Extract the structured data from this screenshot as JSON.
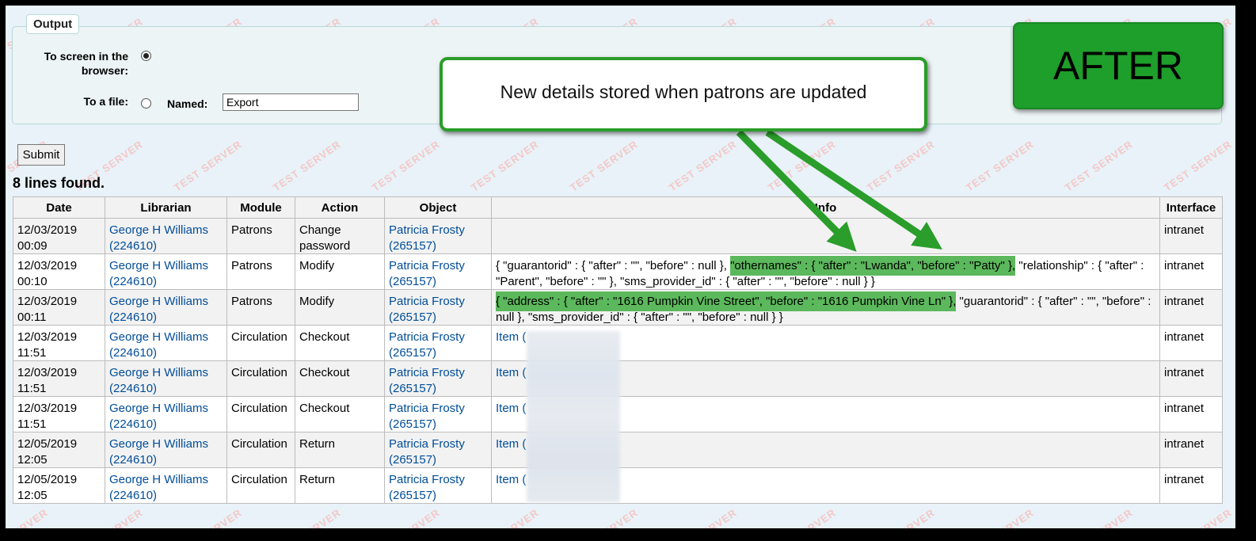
{
  "output": {
    "legend": "Output",
    "to_screen_label": "To screen in the browser:",
    "to_file_label": "To a file:",
    "named_label": "Named:",
    "named_value": "Export"
  },
  "submit_label": "Submit",
  "lines_found": "8 lines found.",
  "watermark": "TEST SERVER",
  "table": {
    "headers": [
      "Date",
      "Librarian",
      "Module",
      "Action",
      "Object",
      "Info",
      "Interface"
    ],
    "rows": [
      {
        "date": "12/03/2019",
        "time": "00:09",
        "librarian": "George H Williams",
        "librarian_id": "(224610)",
        "module": "Patrons",
        "action": "Change password",
        "object": "Patricia Frosty",
        "object_id": "(265157)",
        "info_pre": "",
        "info_hl": "",
        "info_post": "",
        "interface": "intranet"
      },
      {
        "date": "12/03/2019",
        "time": "00:10",
        "librarian": "George H Williams",
        "librarian_id": "(224610)",
        "module": "Patrons",
        "action": "Modify",
        "object": "Patricia Frosty",
        "object_id": "(265157)",
        "info_pre": "{ \"guarantorid\" : { \"after\" : \"\", \"before\" : null }, ",
        "info_hl": "\"othernames\" : { \"after\" : \"Lwanda\", \"before\" : \"Patty\" },",
        "info_post": " \"relationship\" : { \"after\" : \"Parent\", \"before\" : \"\" }, \"sms_provider_id\" : { \"after\" : \"\", \"before\" : null } }",
        "interface": "intranet"
      },
      {
        "date": "12/03/2019",
        "time": "00:11",
        "librarian": "George H Williams",
        "librarian_id": "(224610)",
        "module": "Patrons",
        "action": "Modify",
        "object": "Patricia Frosty",
        "object_id": "(265157)",
        "info_pre": "",
        "info_hl": "{ \"address\" : { \"after\" : \"1616 Pumpkin Vine Street\", \"before\" : \"1616 Pumpkin Vine Ln\" },",
        "info_post": " \"guarantorid\" : { \"after\" : \"\", \"before\" : null }, \"sms_provider_id\" : { \"after\" : \"\", \"before\" : null } }",
        "interface": "intranet"
      },
      {
        "date": "12/03/2019",
        "time": "11:51",
        "librarian": "George H Williams",
        "librarian_id": "(224610)",
        "module": "Circulation",
        "action": "Checkout",
        "object": "Patricia Frosty",
        "object_id": "(265157)",
        "info_pre": "",
        "info_hl": "",
        "info_post": "",
        "info_link": "Item (",
        "interface": "intranet"
      },
      {
        "date": "12/03/2019",
        "time": "11:51",
        "librarian": "George H Williams",
        "librarian_id": "(224610)",
        "module": "Circulation",
        "action": "Checkout",
        "object": "Patricia Frosty",
        "object_id": "(265157)",
        "info_pre": "",
        "info_hl": "",
        "info_post": "",
        "info_link": "Item (",
        "interface": "intranet"
      },
      {
        "date": "12/03/2019",
        "time": "11:51",
        "librarian": "George H Williams",
        "librarian_id": "(224610)",
        "module": "Circulation",
        "action": "Checkout",
        "object": "Patricia Frosty",
        "object_id": "(265157)",
        "info_pre": "",
        "info_hl": "",
        "info_post": "",
        "info_link": "Item (",
        "interface": "intranet"
      },
      {
        "date": "12/05/2019",
        "time": "12:05",
        "librarian": "George H Williams",
        "librarian_id": "(224610)",
        "module": "Circulation",
        "action": "Return",
        "object": "Patricia Frosty",
        "object_id": "(265157)",
        "info_pre": "",
        "info_hl": "",
        "info_post": "",
        "info_link": "Item (",
        "interface": "intranet"
      },
      {
        "date": "12/05/2019",
        "time": "12:05",
        "librarian": "George H Williams",
        "librarian_id": "(224610)",
        "module": "Circulation",
        "action": "Return",
        "object": "Patricia Frosty",
        "object_id": "(265157)",
        "info_pre": "",
        "info_hl": "",
        "info_post": "",
        "info_link": "Item (",
        "interface": "intranet"
      }
    ]
  },
  "callout_text": "New details stored when patrons are updated",
  "after_label": "AFTER",
  "colors": {
    "highlight": "#5cb85c",
    "callout_border": "#2a9d2a",
    "after_bg": "#1e9e2a",
    "link": "#004d99"
  }
}
